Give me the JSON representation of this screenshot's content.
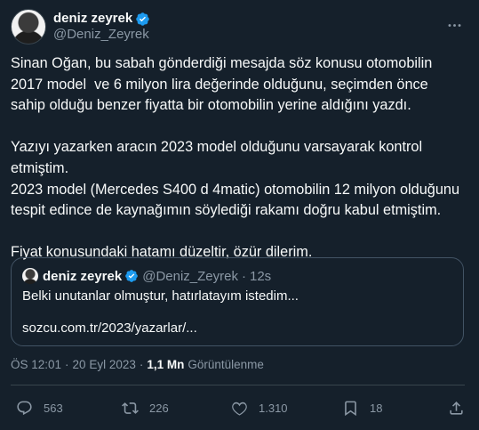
{
  "author": {
    "display_name": "deniz zeyrek",
    "handle": "@Deniz_Zeyrek",
    "verified": true
  },
  "tweet": {
    "text": "Sinan Oğan, bu sabah gönderdiği mesajda söz konusu otomobilin 2017 model  ve 6 milyon lira değerinde olduğunu, seçimden önce sahip olduğu benzer fiyatta bir otomobilin yerine aldığını yazdı.\n\nYazıyı yazarken aracın 2023 model olduğunu varsayarak kontrol etmiştim.\n2023 model (Mercedes S400 d 4matic) otomobilin 12 milyon olduğunu tespit edince de kaynağımın söylediği rakamı doğru kabul etmiştim.\n\nFiyat konusundaki hatamı düzeltir, özür dilerim."
  },
  "quoted_tweet": {
    "display_name": "deniz zeyrek",
    "handle": "@Deniz_Zeyrek",
    "separator": "·",
    "time": "12s",
    "text": "Belki unutanlar olmuştur, hatırlatayım istedim...",
    "link": "sozcu.com.tr/2023/yazarlar/..."
  },
  "meta": {
    "time": "ÖS 12:01",
    "separator": "·",
    "date": "20 Eyl 2023",
    "views_count": "1,1 Mn",
    "views_label": "Görüntülenme"
  },
  "actions": {
    "replies": "563",
    "retweets": "226",
    "likes": "1.310",
    "bookmarks": "18"
  },
  "icons": [
    "verified-badge-icon",
    "more-icon",
    "reply-icon",
    "retweet-icon",
    "like-icon",
    "bookmark-icon",
    "share-icon"
  ],
  "colors": {
    "background": "#15202b",
    "text": "#f7f9f9",
    "secondary_text": "#8b98a5",
    "verified": "#1d9bf0",
    "border": "#38444d"
  }
}
